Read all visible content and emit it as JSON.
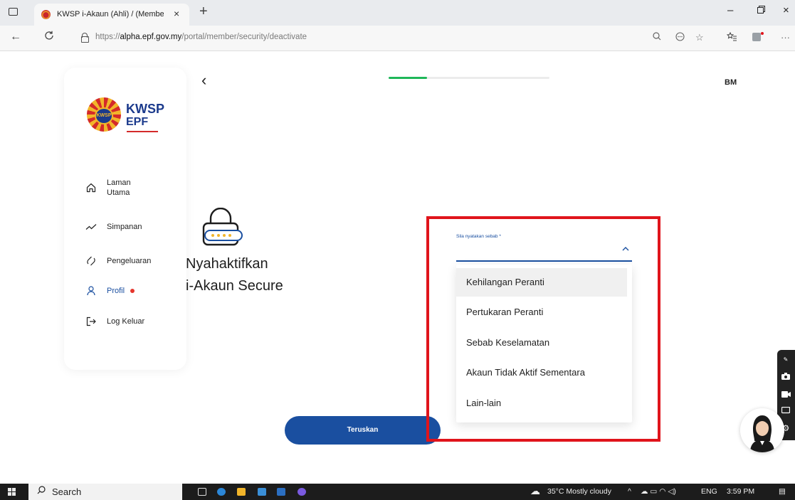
{
  "browser": {
    "tab_title": "KWSP i-Akaun (Ahli) / (Member) |",
    "tab_close": "×",
    "new_tab": "+",
    "url_prefix": "https://",
    "url_domain": "alpha.epf.gov.my",
    "url_path": "/portal/member/security/deactivate",
    "window_minimize": "–",
    "window_restore": "▫",
    "window_close": "×"
  },
  "header": {
    "back": "‹",
    "progress_percent": 24,
    "language": "BM"
  },
  "logo": {
    "kwsp": "KWSP",
    "epf": "EPF",
    "emblem": "KWSP"
  },
  "sidebar": {
    "items": [
      {
        "label_line1": "Laman",
        "label_line2": "Utama",
        "icon": "home-icon"
      },
      {
        "label": "Simpanan",
        "icon": "trend-icon"
      },
      {
        "label": "Pengeluaran",
        "icon": "withdraw-icon"
      },
      {
        "label": "Profil",
        "icon": "user-icon",
        "active": true
      },
      {
        "label": "Log Keluar",
        "icon": "logout-icon"
      }
    ]
  },
  "main": {
    "heading_line1": "Nyahaktifkan",
    "heading_line2": "i-Akaun Secure",
    "field_label": "Sila nyatakan sebab *",
    "options": [
      "Kehilangan Peranti",
      "Pertukaran Peranti",
      "Sebab Keselamatan",
      "Akaun Tidak Aktif Sementara",
      "Lain-lain"
    ],
    "submit_label": "Teruskan"
  },
  "taskbar": {
    "search_label": "Search",
    "weather": "35°C  Mostly cloudy",
    "language": "ENG",
    "time": "3:59 PM"
  },
  "colors": {
    "primary": "#1a4fa0",
    "progress": "#1fb759",
    "highlight": "#e0141b",
    "notification_dot": "#e5352c"
  }
}
